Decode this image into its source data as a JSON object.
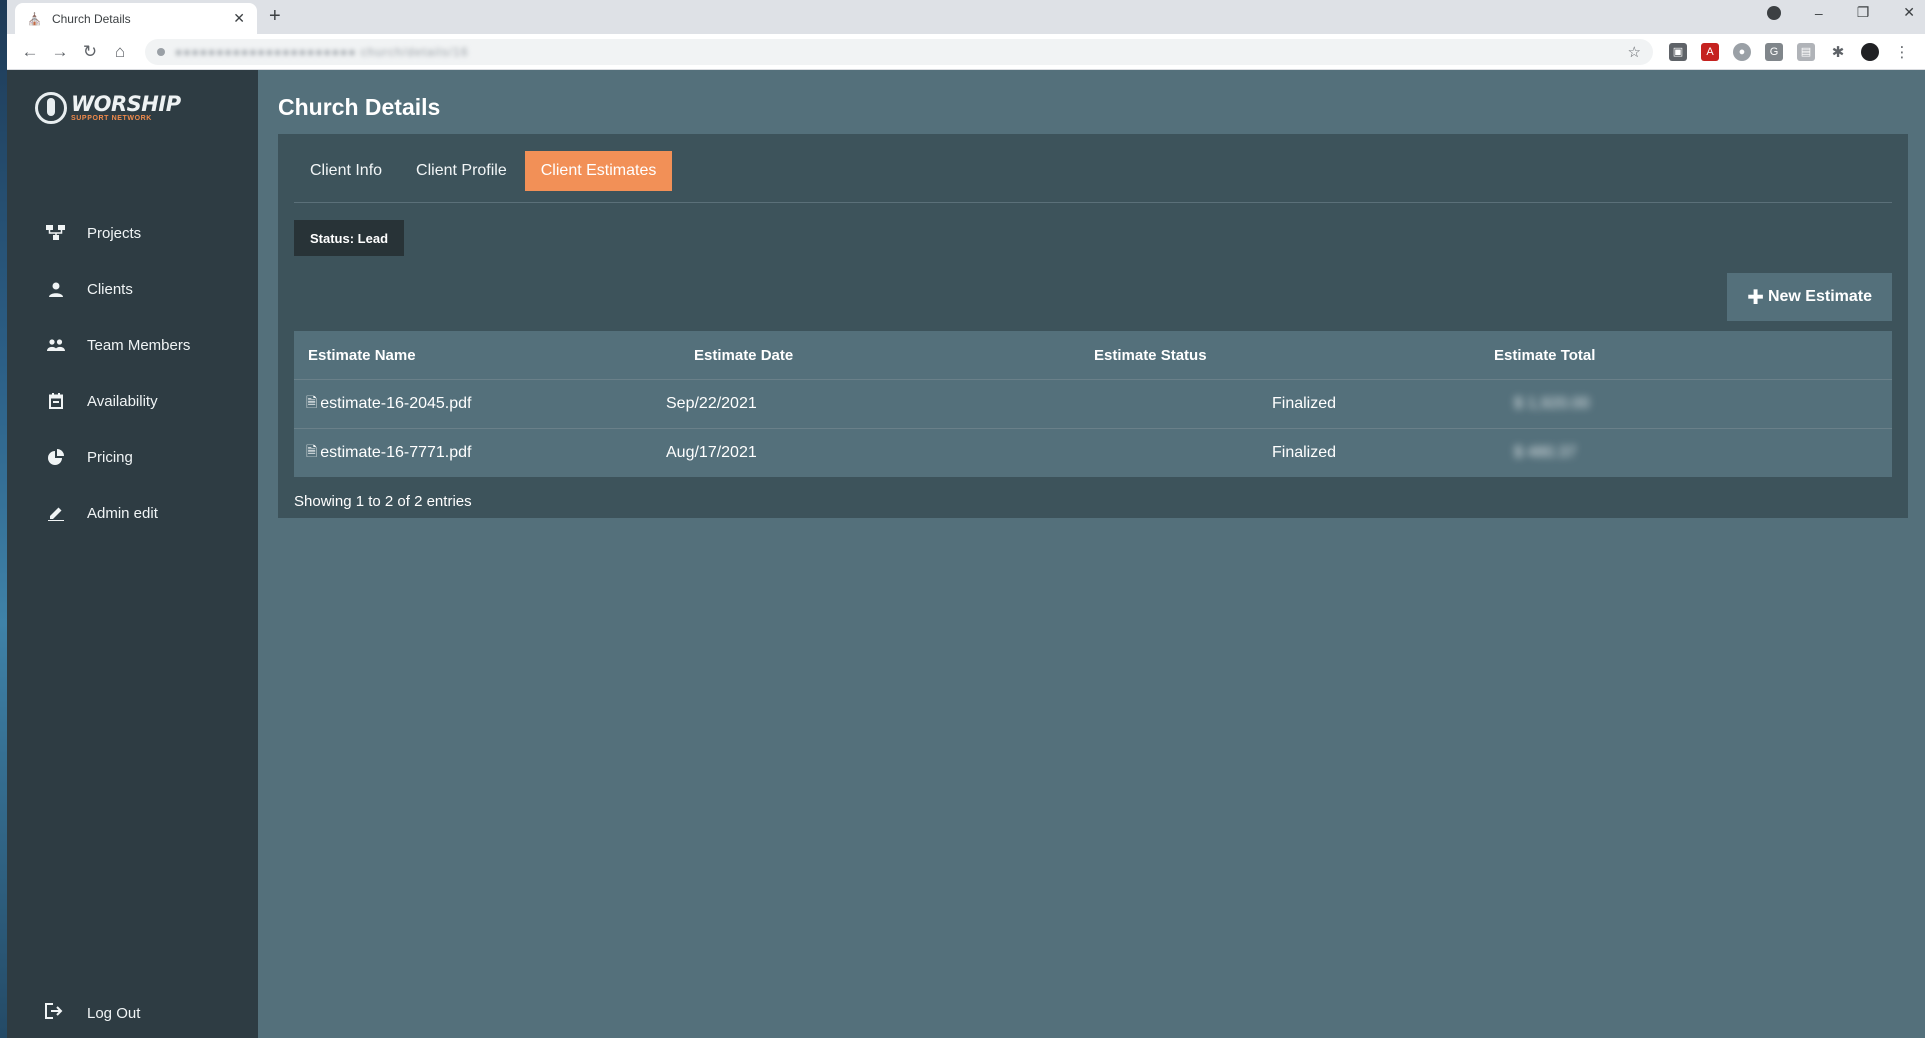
{
  "browser": {
    "tab_title": "Church Details",
    "url": "●●●●●●●●●●●●●●●●●●●●●● church/details/16"
  },
  "brand": {
    "name": "WORSHIP",
    "tagline": "SUPPORT NETWORK",
    "accent": "#f29057"
  },
  "sidebar": {
    "items": [
      {
        "label": "Projects",
        "icon": "sitemap-icon"
      },
      {
        "label": "Clients",
        "icon": "person-icon"
      },
      {
        "label": "Team Members",
        "icon": "people-icon"
      },
      {
        "label": "Availability",
        "icon": "calendar-icon"
      },
      {
        "label": "Pricing",
        "icon": "pie-chart-icon"
      },
      {
        "label": "Admin edit",
        "icon": "pencil-icon"
      }
    ],
    "logout_label": "Log Out"
  },
  "page": {
    "title": "Church Details",
    "tabs": [
      {
        "label": "Client Info",
        "active": false
      },
      {
        "label": "Client Profile",
        "active": false
      },
      {
        "label": "Client Estimates",
        "active": true
      }
    ],
    "status_label": "Status: Lead",
    "new_estimate_label": "New Estimate"
  },
  "table": {
    "headers": [
      "Estimate Name",
      "Estimate Date",
      "Estimate Status",
      "Estimate Total"
    ],
    "rows": [
      {
        "name": "estimate-16-2045.pdf",
        "date": "Sep/22/2021",
        "status": "Finalized",
        "total": "$ 1,920.00"
      },
      {
        "name": "estimate-16-7771.pdf",
        "date": "Aug/17/2021",
        "status": "Finalized",
        "total": "$ 480.37"
      }
    ],
    "footer": "Showing 1 to 2 of 2 entries"
  }
}
